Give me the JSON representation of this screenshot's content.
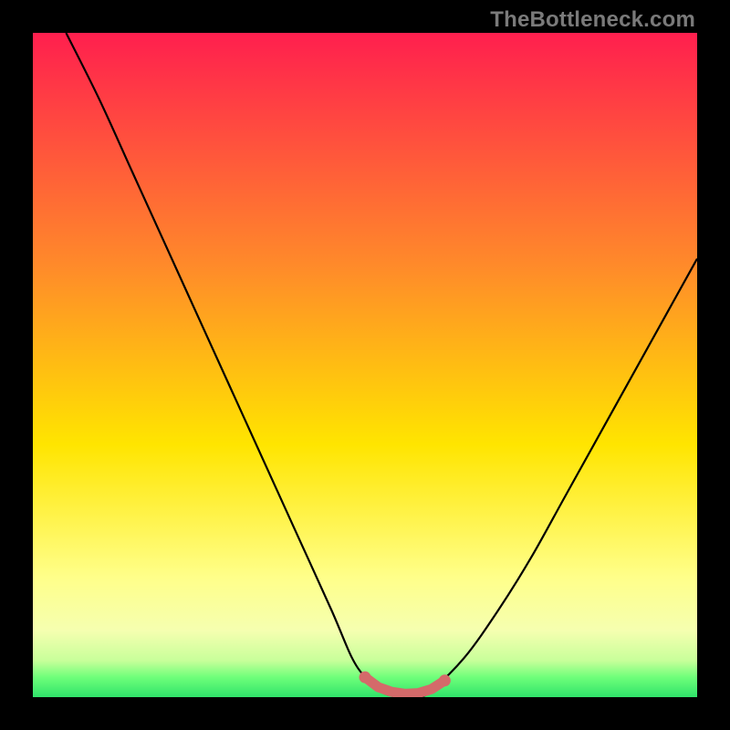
{
  "watermark": "TheBottleneck.com",
  "colors": {
    "frame": "#000000",
    "curve": "#000000",
    "marker": "#d46a6a",
    "green_band": "#2fe36a"
  },
  "chart_data": {
    "type": "line",
    "title": "",
    "xlabel": "",
    "ylabel": "",
    "xlim": [
      0,
      100
    ],
    "ylim": [
      0,
      100
    ],
    "grid": false,
    "legend": false,
    "background_gradient_stops": [
      {
        "offset": 0.0,
        "color": "#ff1f4e"
      },
      {
        "offset": 0.35,
        "color": "#ff8a2a"
      },
      {
        "offset": 0.62,
        "color": "#ffe500"
      },
      {
        "offset": 0.82,
        "color": "#ffff8a"
      },
      {
        "offset": 0.9,
        "color": "#f5ffb0"
      },
      {
        "offset": 0.945,
        "color": "#c8ff9a"
      },
      {
        "offset": 0.97,
        "color": "#6fff7a"
      },
      {
        "offset": 1.0,
        "color": "#2fe36a"
      }
    ],
    "series": [
      {
        "name": "bottleneck-curve",
        "x": [
          5,
          10,
          15,
          20,
          25,
          30,
          35,
          40,
          45,
          48,
          50,
          52,
          55,
          58,
          60,
          65,
          70,
          75,
          80,
          85,
          90,
          95,
          100
        ],
        "y": [
          100,
          90,
          79,
          68,
          57,
          46,
          35,
          24,
          13,
          6,
          3,
          1,
          0,
          0,
          1,
          6,
          13,
          21,
          30,
          39,
          48,
          57,
          66
        ]
      }
    ],
    "markers": {
      "name": "optimal-range",
      "x": [
        50,
        52,
        54,
        56,
        58,
        60,
        62
      ],
      "y": [
        3,
        1.5,
        0.8,
        0.5,
        0.6,
        1.2,
        2.5
      ]
    }
  }
}
